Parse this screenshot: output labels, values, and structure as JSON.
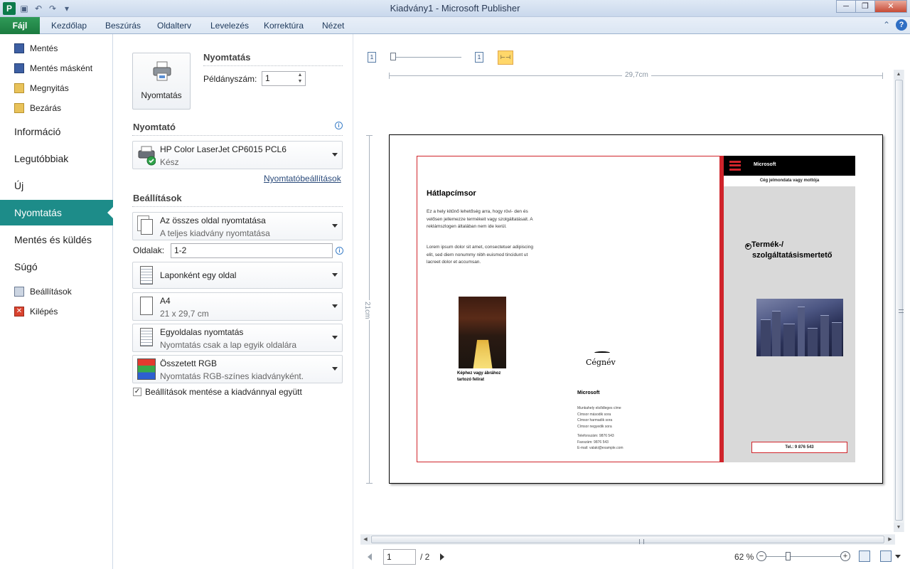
{
  "window": {
    "title": "Kiadvány1 - Microsoft Publisher",
    "app_icon": "P"
  },
  "ribbon": {
    "file_tab": "Fájl",
    "tabs": [
      "Kezdőlap",
      "Beszúrás",
      "Oldalterv",
      "Levelezés",
      "Korrektúra",
      "Nézet"
    ]
  },
  "nav": {
    "save": "Mentés",
    "save_as": "Mentés másként",
    "open": "Megnyitás",
    "close": "Bezárás",
    "info": "Információ",
    "recent": "Legutóbbiak",
    "new": "Új",
    "print": "Nyomtatás",
    "save_send": "Mentés és küldés",
    "help": "Súgó",
    "options": "Beállítások",
    "exit": "Kilépés"
  },
  "print_panel": {
    "print_button": "Nyomtatás",
    "section_title": "Nyomtatás",
    "copies_label": "Példányszám:",
    "copies_value": "1",
    "printer_header": "Nyomtató",
    "printer_name": "HP Color LaserJet CP6015 PCL6",
    "printer_status": "Kész",
    "printer_settings_link": "Nyomtatóbeállítások",
    "settings_header": "Beállítások",
    "range_title": "Az összes oldal nyomtatása",
    "range_sub": "A teljes kiadvány nyomtatása",
    "pages_label": "Oldalak:",
    "pages_value": "1-2",
    "layout_title": "Laponként egy oldal",
    "paper_title": "A4",
    "paper_sub": "21 x 29,7 cm",
    "sides_title": "Egyoldalas nyomtatás",
    "sides_sub": "Nyomtatás csak a lap egyik oldalára",
    "color_title": "Összetett RGB",
    "color_sub": "Nyomtatás RGB-színes kiadványként.",
    "save_settings_label": "Beállítások mentése a kiadvánnyal együtt",
    "save_settings_checked": true
  },
  "preview": {
    "width_label": "29,7cm",
    "height_label": "21cm",
    "page_input": "1",
    "page_total": "/ 2",
    "zoom": "62 %",
    "zoom_level_percent": 62,
    "doc": {
      "company_header": "Microsoft",
      "motto": "Cég jelmondata vagy mottója",
      "product_title_line1": "Termék-/",
      "product_title_line2": "szolgáltatásismertető",
      "phone_box": "Tel.: 9 876 543",
      "back_title": "Hátlapcímsor",
      "back_p1": "Ez a hely kitűnő lehetőség arra, hogy rövi- den és velősen jellemezze termékeit vagy szolgáltatásait. A reklámszlogen általában nem ide kerül.",
      "back_p2": "Lorem ipsum dolor sit amet, consectetuer adipiscing elit, sed diem nonummy nibh euismod tincidunt ut lacreet dolor et accumsan.",
      "caption": "Képhez vagy ábrához tartozó felirat",
      "logo_name": "Cégnév",
      "company_name": "Microsoft",
      "address_lines": [
        "Munkahely elsődleges címe",
        "Címsor második sora",
        "Címsor harmadik sora",
        "Címsor negyedik sora"
      ],
      "contact_lines": [
        "Telefonszám: 9876 543",
        "Faxszám: 9876 543",
        "E-mail: valaki@example.com"
      ]
    }
  }
}
